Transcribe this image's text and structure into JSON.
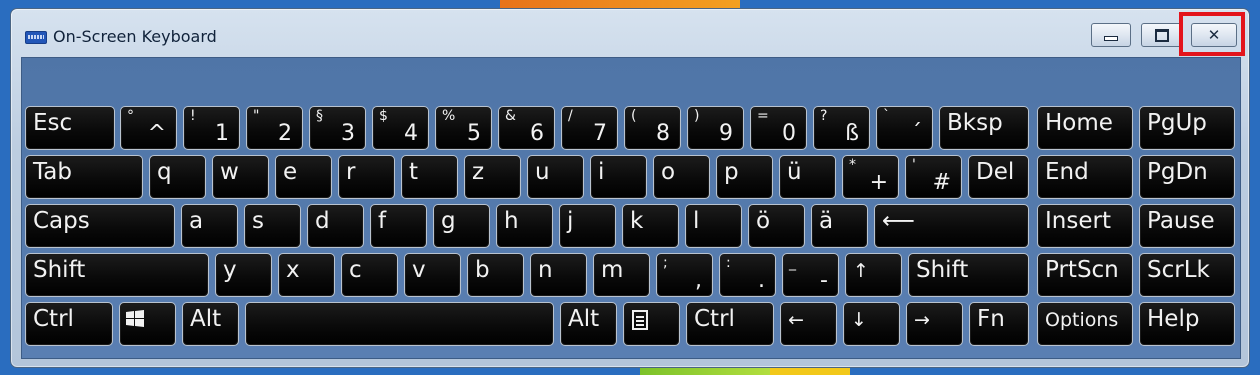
{
  "window": {
    "title": "On-Screen Keyboard"
  },
  "keyboard": {
    "row1": [
      {
        "label": "Esc"
      },
      {
        "top": "°",
        "bottom": "^"
      },
      {
        "top": "!",
        "bottom": "1"
      },
      {
        "top": "\"",
        "bottom": "2"
      },
      {
        "top": "§",
        "bottom": "3"
      },
      {
        "top": "$",
        "bottom": "4"
      },
      {
        "top": "%",
        "bottom": "5"
      },
      {
        "top": "&",
        "bottom": "6"
      },
      {
        "top": "/",
        "bottom": "7"
      },
      {
        "top": "(",
        "bottom": "8"
      },
      {
        "top": ")",
        "bottom": "9"
      },
      {
        "top": "=",
        "bottom": "0"
      },
      {
        "top": "?",
        "bottom": "ß"
      },
      {
        "top": "`",
        "bottom": "´"
      },
      {
        "label": "Bksp"
      }
    ],
    "row2": [
      {
        "label": "Tab"
      },
      {
        "label": "q"
      },
      {
        "label": "w"
      },
      {
        "label": "e"
      },
      {
        "label": "r"
      },
      {
        "label": "t"
      },
      {
        "label": "z"
      },
      {
        "label": "u"
      },
      {
        "label": "i"
      },
      {
        "label": "o"
      },
      {
        "label": "p"
      },
      {
        "label": "ü"
      },
      {
        "top": "*",
        "bottom": "+"
      },
      {
        "top": "'",
        "bottom": "#"
      },
      {
        "label": "Del"
      }
    ],
    "row3": [
      {
        "label": "Caps"
      },
      {
        "label": "a"
      },
      {
        "label": "s"
      },
      {
        "label": "d"
      },
      {
        "label": "f"
      },
      {
        "label": "g"
      },
      {
        "label": "h"
      },
      {
        "label": "j"
      },
      {
        "label": "k"
      },
      {
        "label": "l"
      },
      {
        "label": "ö"
      },
      {
        "label": "ä"
      },
      {
        "label": "⟵"
      }
    ],
    "row4": [
      {
        "label": "Shift"
      },
      {
        "label": "y"
      },
      {
        "label": "x"
      },
      {
        "label": "c"
      },
      {
        "label": "v"
      },
      {
        "label": "b"
      },
      {
        "label": "n"
      },
      {
        "label": "m"
      },
      {
        "top": ";",
        "bottom": ","
      },
      {
        "top": ":",
        "bottom": "."
      },
      {
        "top": "_",
        "bottom": "-"
      },
      {
        "label": "↑"
      },
      {
        "label": "Shift"
      }
    ],
    "row5": [
      {
        "label": "Ctrl"
      },
      {
        "label": "windows-logo"
      },
      {
        "label": "Alt"
      },
      {
        "label": ""
      },
      {
        "label": "Alt"
      },
      {
        "label": "menu"
      },
      {
        "label": "Ctrl"
      },
      {
        "label": "←"
      },
      {
        "label": "↓"
      },
      {
        "label": "→"
      },
      {
        "label": "Fn"
      }
    ],
    "nav": [
      {
        "label": "Home"
      },
      {
        "label": "PgUp"
      },
      {
        "label": "End"
      },
      {
        "label": "PgDn"
      },
      {
        "label": "Insert"
      },
      {
        "label": "Pause"
      },
      {
        "label": "PrtScn"
      },
      {
        "label": "ScrLk"
      },
      {
        "label": "Options"
      },
      {
        "label": "Help"
      }
    ]
  }
}
